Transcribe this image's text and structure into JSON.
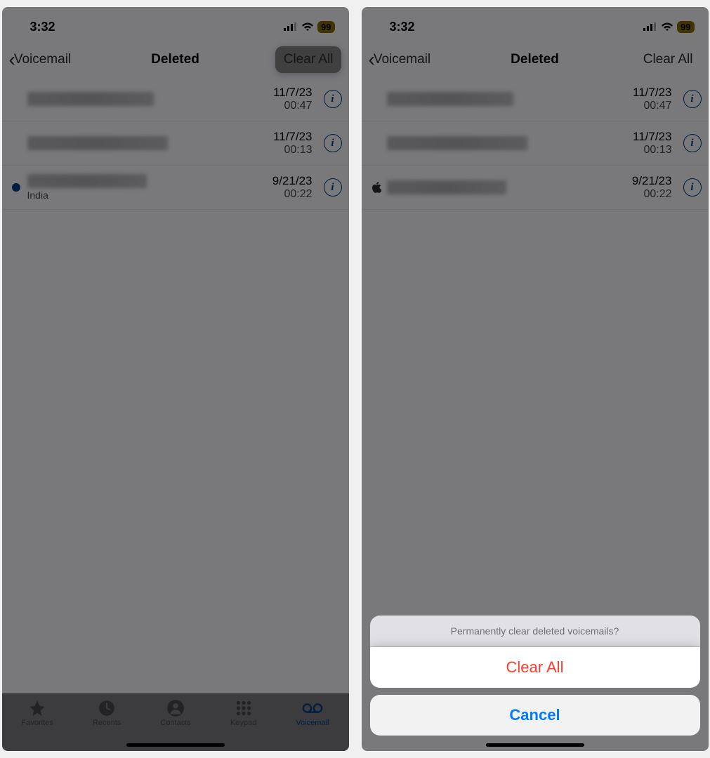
{
  "status": {
    "time": "3:32",
    "battery": "99"
  },
  "nav": {
    "back": "Voicemail",
    "title": "Deleted",
    "clear": "Clear All"
  },
  "rows": [
    {
      "date": "11/7/23",
      "dur": "00:47",
      "sub": "",
      "dot": false,
      "apple": false,
      "nameWidth": "180px"
    },
    {
      "date": "11/7/23",
      "dur": "00:13",
      "sub": "",
      "dot": false,
      "apple": false,
      "nameWidth": "200px"
    },
    {
      "date": "9/21/23",
      "dur": "00:22",
      "sub": "India",
      "dot": true,
      "apple": true,
      "nameWidth": "170px"
    }
  ],
  "tabs": {
    "favorites": "Favorites",
    "recents": "Recents",
    "contacts": "Contacts",
    "keypad": "Keypad",
    "voicemail": "Voicemail"
  },
  "sheet": {
    "message": "Permanently clear deleted voicemails?",
    "clear": "Clear All",
    "cancel": "Cancel"
  }
}
